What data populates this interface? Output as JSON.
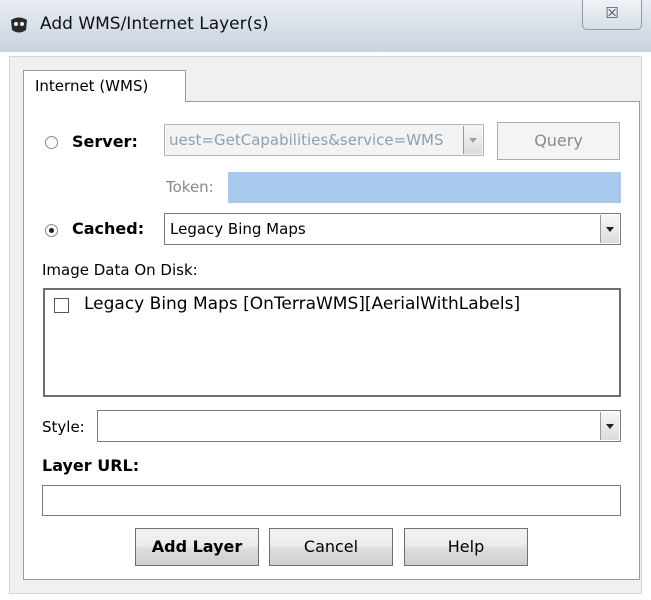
{
  "window": {
    "title": "Add WMS/Internet Layer(s)",
    "close_glyph": "☒",
    "icon": "app-logo-icon"
  },
  "tab": {
    "label": "Internet (WMS)"
  },
  "server": {
    "label": "Server:",
    "selected": false,
    "url_value": "uest=GetCapabilities&service=WMS",
    "query_button": "Query",
    "token_label": "Token:",
    "token_value": ""
  },
  "cached": {
    "label": "Cached:",
    "selected": true,
    "value": "Legacy Bing Maps"
  },
  "image_data": {
    "label": "Image Data On Disk:",
    "items": [
      {
        "label": "Legacy Bing Maps [OnTerraWMS][AerialWithLabels]",
        "checked": false
      }
    ]
  },
  "style": {
    "label": "Style:",
    "value": ""
  },
  "layer_url": {
    "label": "Layer URL:",
    "value": ""
  },
  "buttons": {
    "add_layer": "Add Layer",
    "cancel": "Cancel",
    "help": "Help"
  },
  "colors": {
    "title_bar": "#d9e1ea",
    "token_field": "#a9c8ee"
  }
}
